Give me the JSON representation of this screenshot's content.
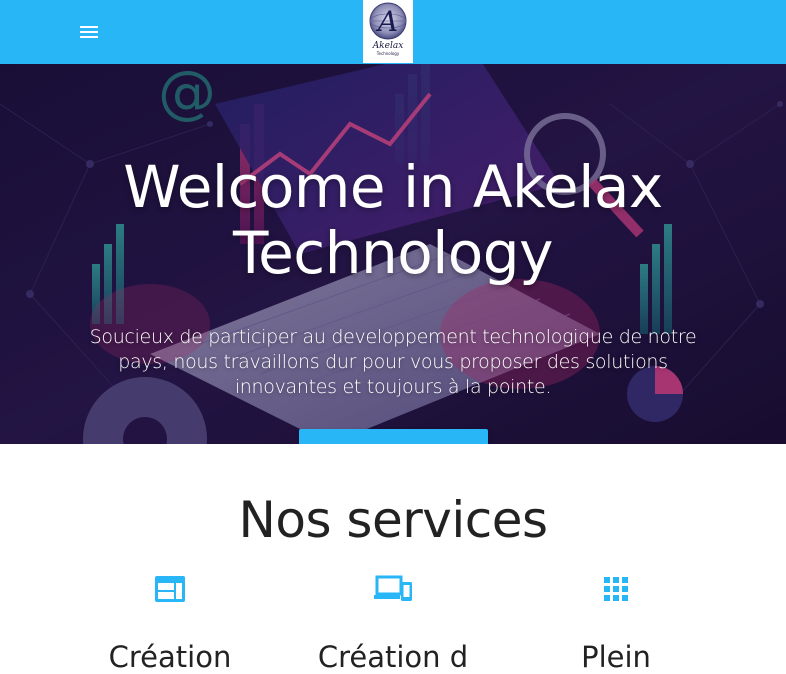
{
  "nav": {
    "menu_icon": "menu-icon",
    "logo_text": "Akelax",
    "logo_subtext": "Technology",
    "logo_letter": "A",
    "bar_color": "#29b6f6"
  },
  "hero": {
    "title_line1": "Welcome in Akelax",
    "title_line2": "Technology",
    "text": "Soucieux de participer au developpement technologique de notre pays, nous travaillons dur pour vous proposer des solutions innovantes et toujours à la pointe.",
    "button_color": "#29b6f6"
  },
  "services": {
    "title": "Nos services",
    "items": [
      {
        "icon": "web-icon",
        "label": "Création"
      },
      {
        "icon": "devices-icon",
        "label": "Création d"
      },
      {
        "icon": "apps-icon",
        "label": "Plein"
      }
    ],
    "icon_color": "#29b6f6"
  }
}
